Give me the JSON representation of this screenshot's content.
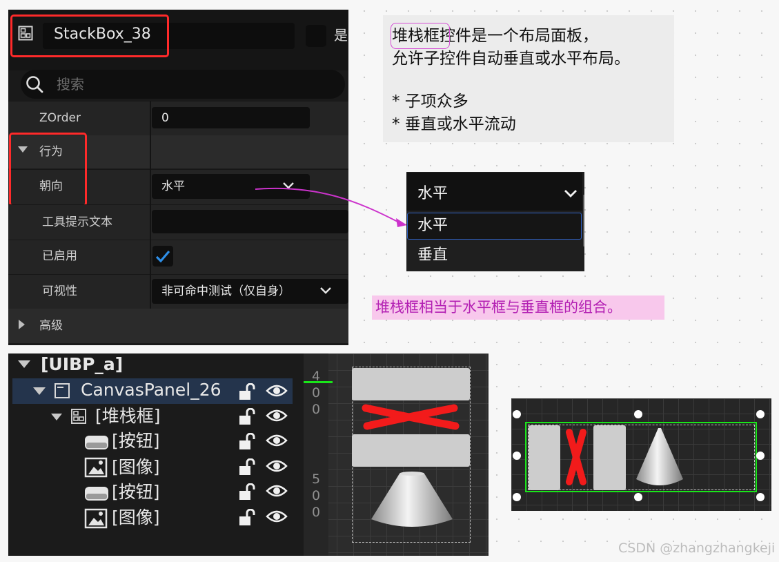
{
  "details": {
    "widget_name": "StackBox_38",
    "is_variable_label": "是",
    "search_placeholder": "搜索",
    "zorder_label": "ZOrder",
    "zorder_value": "0",
    "behavior_section": "行为",
    "orientation_label": "朝向",
    "orientation_value": "水平",
    "tooltip_label": "工具提示文本",
    "tooltip_value": "",
    "enabled_label": "已启用",
    "enabled_checked": true,
    "visibility_label": "可视性",
    "visibility_value": "非可命中测试（仅自身）",
    "advanced_section": "高级"
  },
  "info": {
    "line1_highlight": "堆栈框",
    "line1_rest": "控件是一个布局面板，",
    "line2": "允许子控件自动垂直或水平布局。",
    "bullet1": "* 子项众多",
    "bullet2": "* 垂直或水平流动"
  },
  "dropdown": {
    "selected": "水平",
    "options": [
      "水平",
      "垂直"
    ]
  },
  "note": "堆栈框相当于水平框与垂直框的组合。",
  "hierarchy": {
    "root": "[UIBP_a]",
    "items": [
      {
        "label": "CanvasPanel_26",
        "icon": "canvas-panel-icon"
      },
      {
        "label": "[堆栈框]",
        "icon": "stack-box-icon"
      },
      {
        "label": "[按钮]",
        "icon": "button-icon"
      },
      {
        "label": "[图像]",
        "icon": "image-icon"
      },
      {
        "label": "[按钮]",
        "icon": "button-icon"
      },
      {
        "label": "[图像]",
        "icon": "image-icon"
      }
    ]
  },
  "viewport": {
    "ruler_top": [
      "4",
      "0",
      "0"
    ],
    "ruler_bottom": [
      "5",
      "0",
      "0"
    ]
  },
  "watermark": "CSDN @zhangzhangkeji",
  "colors": {
    "red_highlight": "#ff2a2a",
    "selection_blue": "#24344c",
    "pink_note_bg": "#f8c8ec",
    "pink_note_text": "#b320b3",
    "arrow": "#cc33cc",
    "green_outline": "#19e619"
  }
}
